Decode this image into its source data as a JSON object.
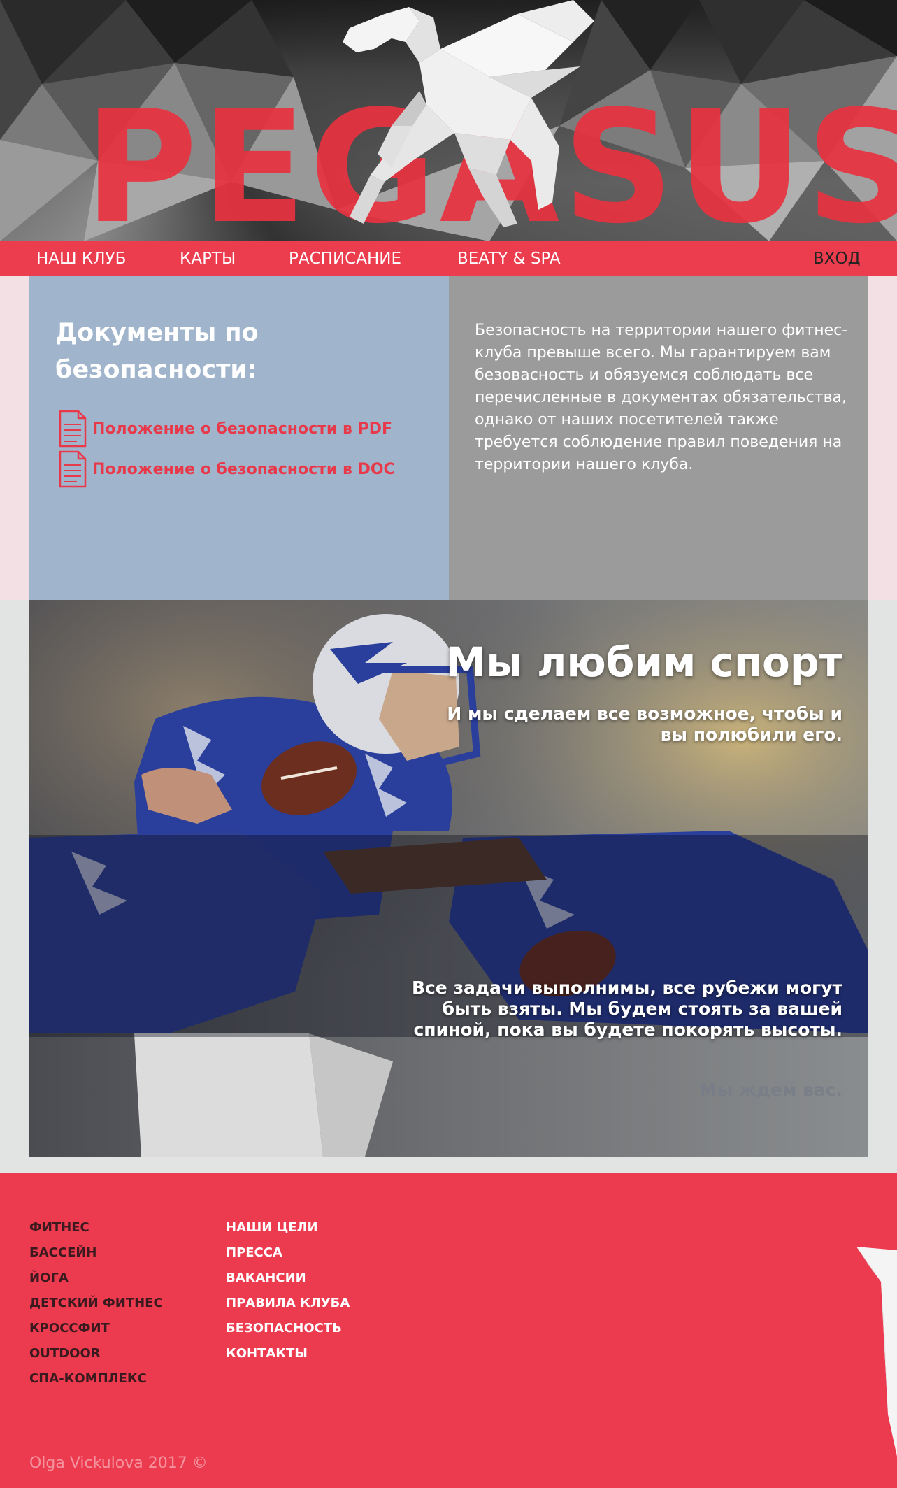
{
  "header": {
    "logo_text": "PEGASUS"
  },
  "nav": {
    "items": [
      {
        "label": "НАШ КЛУБ"
      },
      {
        "label": "КАРТЫ"
      },
      {
        "label": "РАСПИСАНИЕ"
      },
      {
        "label": "BEATY & SPA"
      }
    ],
    "login_label": "ВХОД"
  },
  "docs": {
    "title": "Документы по безопасности:",
    "links": [
      {
        "label": "Положение о безопасности в PDF",
        "icon": "document-icon"
      },
      {
        "label": "Положение о безопасности в DOC",
        "icon": "document-icon"
      }
    ]
  },
  "info": {
    "text": "Безопасность на территории нашего фитнес-клуба превыше всего. Мы гарантируем вам безовасность и обязуемся соблюдать все перечисленные в документах обязательства, однако от наших посетителей также требуется соблюдение правил поведения на территории нашего клуба."
  },
  "sport": {
    "heading": "Мы любим спорт",
    "subheading": "И мы сделаем все возможное, чтобы и вы полюбили его.",
    "body": "Все задачи выполнимы, все рубежи могут быть взяты. Мы будем стоять за вашей спиной, пока вы будете покорять высоты.",
    "closing": "Мы ждем вас."
  },
  "footer": {
    "col1": [
      "ФИТНЕС",
      "БАССЕЙН",
      "ЙОГА",
      "ДЕТСКИЙ ФИТНЕС",
      "КРОССФИТ",
      "OUTDOOR",
      "СПА-КОМПЛЕКС"
    ],
    "col2": [
      "НАШИ ЦЕЛИ",
      "ПРЕССА",
      "ВАКАНСИИ",
      "ПРАВИЛА КЛУБА",
      "БЕЗОПАСНОСТЬ",
      "КОНТАКТЫ"
    ],
    "copyright": "Olga Vickulova 2017 ©"
  },
  "colors": {
    "brand_red": "#ec3d4f",
    "link_red": "#e8394a",
    "docs_panel": "#a0b5cc",
    "info_panel": "#9b9b9b"
  }
}
